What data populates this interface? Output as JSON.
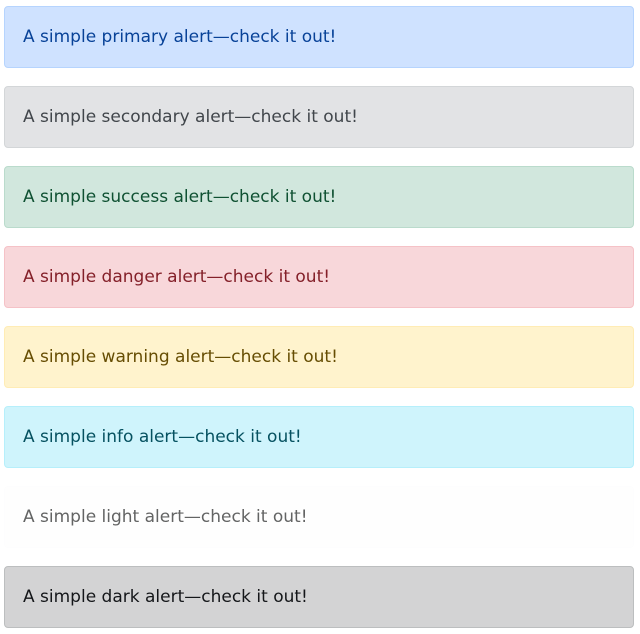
{
  "alerts": [
    {
      "variant": "primary",
      "text": "A simple primary alert—check it out!",
      "bg": "#cfe2ff",
      "border": "#b6d4fe",
      "color": "#084298"
    },
    {
      "variant": "secondary",
      "text": "A simple secondary alert—check it out!",
      "bg": "#e2e3e5",
      "border": "#d3d6d8",
      "color": "#41464b"
    },
    {
      "variant": "success",
      "text": "A simple success alert—check it out!",
      "bg": "#d1e7dd",
      "border": "#badbcc",
      "color": "#0f5132"
    },
    {
      "variant": "danger",
      "text": "A simple danger alert—check it out!",
      "bg": "#f8d7da",
      "border": "#f5c2c7",
      "color": "#842029"
    },
    {
      "variant": "warning",
      "text": "A simple warning alert—check it out!",
      "bg": "#fff3cd",
      "border": "#ffecb5",
      "color": "#664d03"
    },
    {
      "variant": "info",
      "text": "A simple info alert—check it out!",
      "bg": "#cff4fc",
      "border": "#b6effb",
      "color": "#055160"
    },
    {
      "variant": "light",
      "text": "A simple light alert—check it out!",
      "bg": "#fefefe",
      "border": "#fdfdfe",
      "color": "#636464"
    },
    {
      "variant": "dark",
      "text": "A simple dark alert—check it out!",
      "bg": "#d3d3d4",
      "border": "#bcbebf",
      "color": "#141619"
    }
  ]
}
